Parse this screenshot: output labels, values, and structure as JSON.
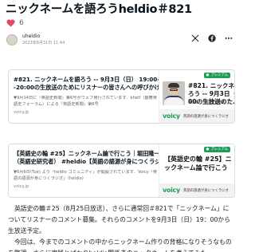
{
  "article": {
    "title": "ニックネームを語ろうheldio＃821",
    "like_count": "6",
    "author_name": "uheldio",
    "author_date": "2023年8月31日 11:44"
  },
  "share": {
    "icons": [
      "x-icon",
      "facebook-icon",
      "more-icon"
    ]
  },
  "cards": [
    {
      "title": "#821. ニックネームを語ろう -- 9月3日（日） 19:00--20:00の生放送のためにリスナーの皆さんへの呼びかけ｜...",
      "desc": "▼9月14日に『英語史新聞』第6号がウェブ発行されています．khelf（慶應英語史フォーラム）による『英語史新聞』第6号",
      "host": "voicy.jp",
      "thumb_badge": "プレミアム",
      "thumb_title": "#821. ニックネームを\nろう -- 9月3日（日）\n00の生放送のた...",
      "thumb_host": "堀田隆一（英語史研究者）",
      "thumb_footer": "英語の語源が身につくラジオ"
    },
    {
      "title": "【英語史の輪 #25】ニックネーム論で行こう｜堀田隆一（英語史研究者） #heldio【英語の語源が身につくラジオ",
      "desc": "▼6月6日(Tue) より「heldio コミュニティ」が開設されています．Voicy「英語の語源が身につくラジオ」（heldio）",
      "host": "voicy.jp",
      "thumb_badge": "プレミアム",
      "thumb_title": "【英語史の輪 #25】ニ\nックネーム論で行こう",
      "thumb_footer": "英語の語源が身につくラジオ"
    }
  ],
  "body": {
    "paragraph1": "英語史の輪＃25（8月25日放送）、さらに通常回＃821で「ニックネーム」についてリスナーのコメント募集。それらのコメントを9月3日（日）19：00から生放送予定。",
    "paragraph2": "今回は、今までのコメントの中からニックネーム作りの背格になりそうなものを整理、さらに実践とばかりheldio関係者のニックネームを考えてみた。"
  }
}
